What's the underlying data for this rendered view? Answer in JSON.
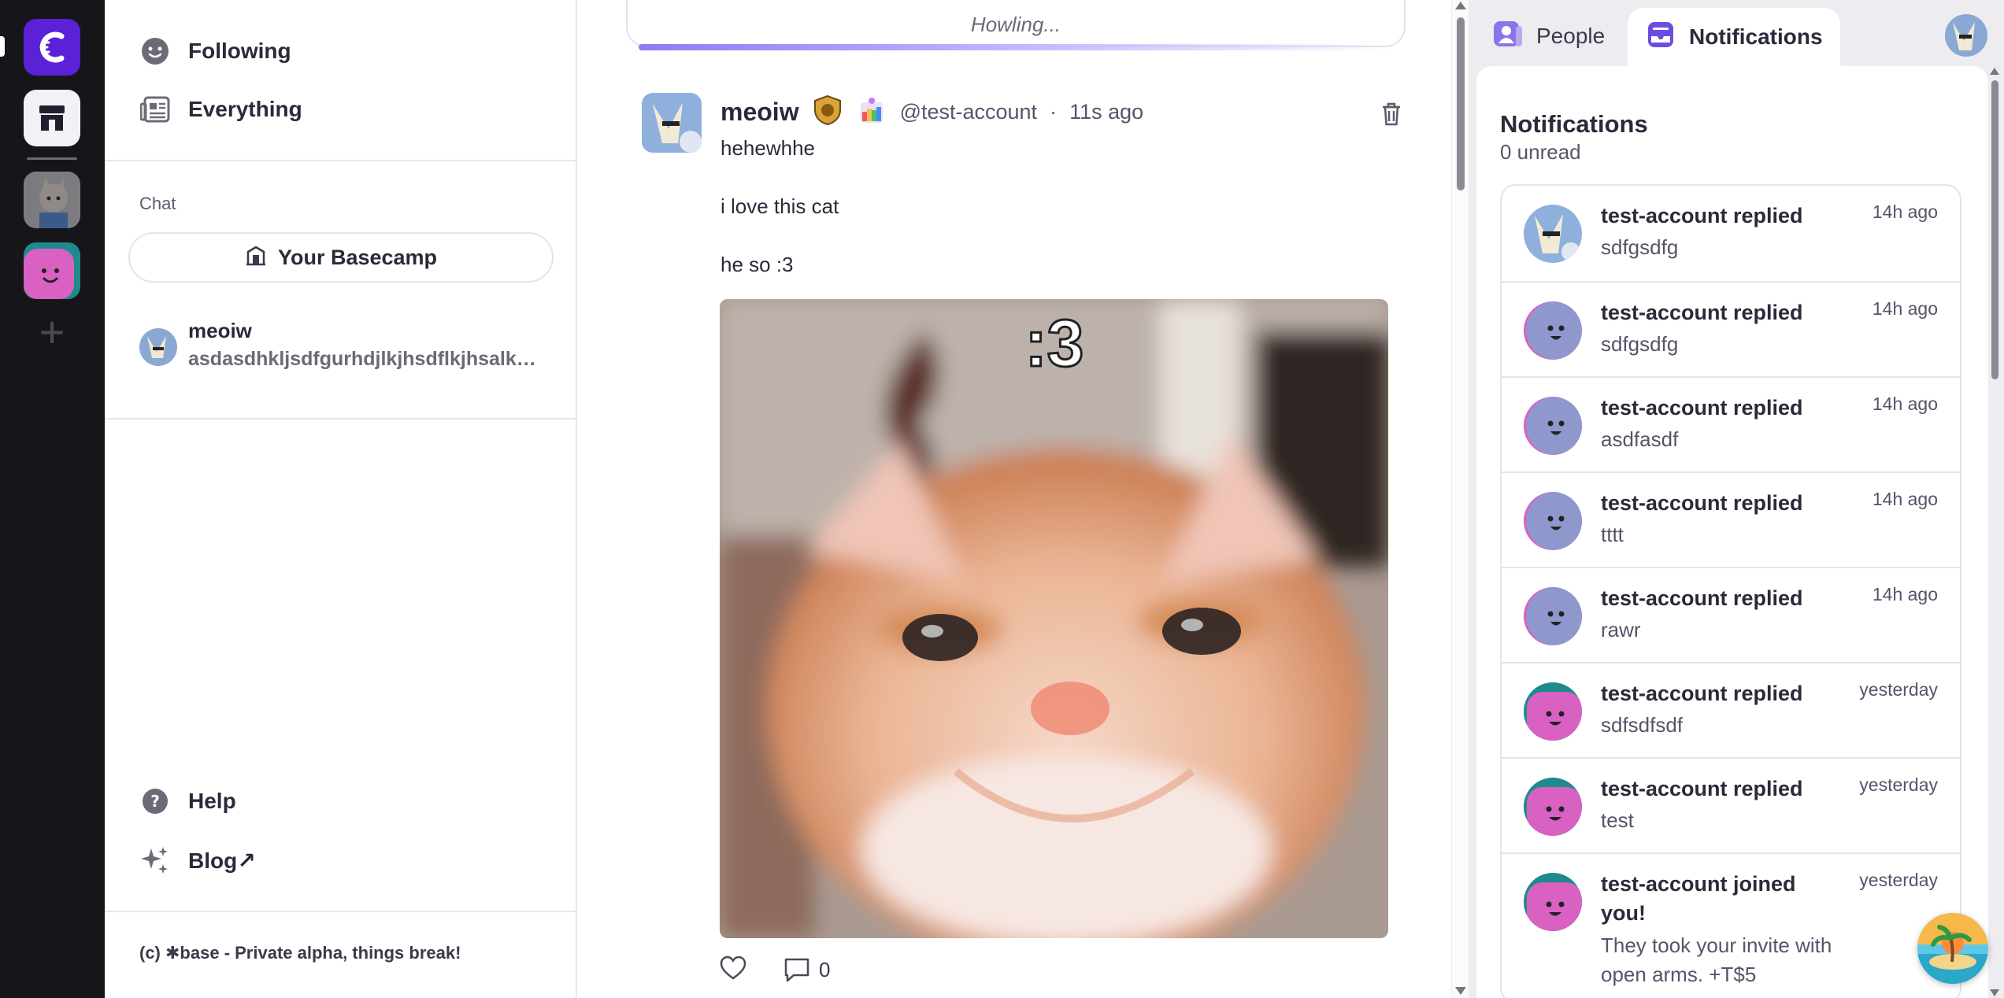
{
  "sidebar": {
    "nav": [
      {
        "label": "Following"
      },
      {
        "label": "Everything"
      }
    ],
    "chat_heading": "Chat",
    "basecamp_label": "Your Basecamp",
    "chat_item": {
      "name": "meoiw",
      "preview": "asdasdhkljsdfgurhdjlkjhsdflkjhsalkdjfhsdfsdf"
    },
    "bottom_nav": [
      {
        "label": "Help"
      },
      {
        "label": "Blog↗"
      }
    ],
    "footer": "(c) ✱base - Private alpha, things break!"
  },
  "composer": {
    "placeholder": "Howling..."
  },
  "post": {
    "author": "meoiw",
    "handle": "@test-account",
    "separator": "·",
    "time": "11s ago",
    "lines": [
      "hehewhhe",
      "i love this cat",
      "he so :3"
    ],
    "image_caption": ":3",
    "comment_count": "0"
  },
  "right_panel": {
    "tabs": [
      {
        "label": "People"
      },
      {
        "label": "Notifications"
      }
    ],
    "title": "Notifications",
    "unread": "0 unread",
    "notifications": [
      {
        "title": "test-account replied",
        "subtitle": "sdfgsdfg",
        "time": "14h ago",
        "avatar": "fox"
      },
      {
        "title": "test-account replied",
        "subtitle": "sdfgsdfg",
        "time": "14h ago",
        "avatar": "blue-smiley"
      },
      {
        "title": "test-account replied",
        "subtitle": "asdfasdf",
        "time": "14h ago",
        "avatar": "blue-smiley"
      },
      {
        "title": "test-account replied",
        "subtitle": "tttt",
        "time": "14h ago",
        "avatar": "blue-smiley"
      },
      {
        "title": "test-account replied",
        "subtitle": "rawr",
        "time": "14h ago",
        "avatar": "blue-smiley"
      },
      {
        "title": "test-account replied",
        "subtitle": "sdfsdfsdf",
        "time": "yesterday",
        "avatar": "pink-smiley"
      },
      {
        "title": "test-account replied",
        "subtitle": "test",
        "time": "yesterday",
        "avatar": "pink-smiley"
      },
      {
        "title": "test-account joined you!",
        "subtitle": "They took your invite with open arms. +T$5",
        "time": "yesterday",
        "avatar": "pink-smiley"
      }
    ]
  },
  "colors": {
    "rail_bg": "#16161a",
    "brand_purple": "#5b21d6",
    "accent_purple": "#6d4de0",
    "tab_bg": "#ececf1",
    "text_dark": "#2a2a3a",
    "text_muted": "#55556a"
  }
}
